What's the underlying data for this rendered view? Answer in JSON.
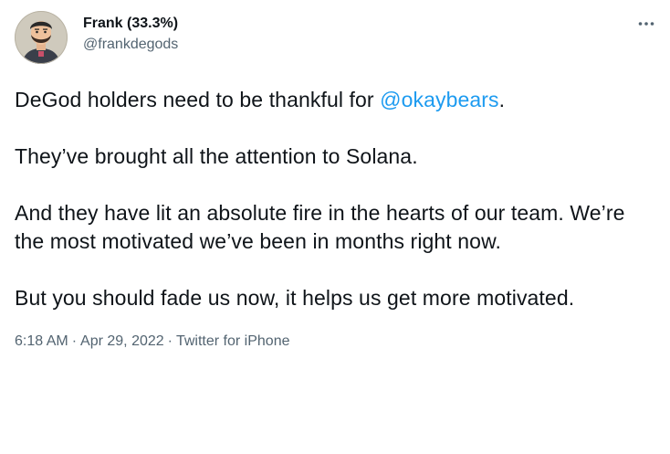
{
  "author": {
    "display_name": "Frank (33.3%)",
    "handle": "@frankdegods",
    "avatar_icon": "cartoon-avatar-icon"
  },
  "more_icon": "more-horizontal-icon",
  "tweet": {
    "paragraph_1_text": "DeGod holders need to be thankful for ",
    "paragraph_1_mention": "@okaybears",
    "paragraph_1_end": ".",
    "paragraph_2": "They’ve brought all the attention to Solana.",
    "paragraph_3": "And they have lit an absolute fire in the hearts of our team. We’re the most motivated we’ve been in months right now.",
    "paragraph_4": "But you should fade us now, it helps us get more motivated."
  },
  "meta": {
    "time": "6:18 AM",
    "date": "Apr 29, 2022",
    "source": "Twitter for iPhone",
    "separator": "·"
  },
  "colors": {
    "text": "#0f1419",
    "secondary": "#536471",
    "link": "#1d9bf0"
  }
}
